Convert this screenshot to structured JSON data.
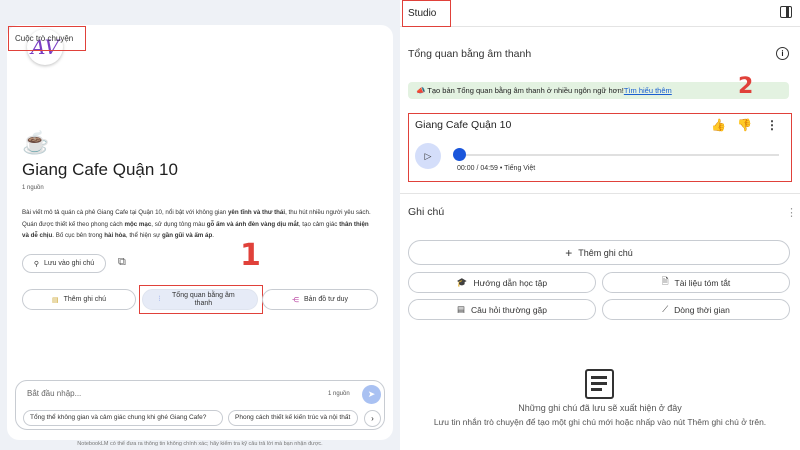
{
  "left": {
    "tab_label": "Cuộc trò chuyện",
    "source_emoji": "☕",
    "source_title": "Giang Cafe Quận 10",
    "source_count": "1 nguồn",
    "summary": {
      "p1": "Bài viết mô tả quán cà phê Giang Cafe tại Quận 10, nổi bật với không gian ",
      "b1": "yên tĩnh và thư thái",
      "p2": ", thu hút nhiều người yêu sách. Quán được thiết kế theo phong cách ",
      "b2": "mộc mạc",
      "p3": ", sử dụng tông màu ",
      "b3": "gỗ ấm và ánh đèn vàng dịu mắt",
      "p4": ", tạo cảm giác ",
      "b4": "thân thiện và dễ chịu",
      "p5": ". Bố cục bên trong ",
      "b5": "hài hòa",
      "p6": ", thể hiện sự ",
      "b6": "gần gũi và ấm áp",
      "p7": "."
    },
    "save_note_label": "Lưu vào ghi chú",
    "actions": {
      "add_note": "Thêm ghi chú",
      "audio_overview": "Tổng quan bằng âm thanh",
      "mind_map": "Bản đồ tư duy"
    },
    "annotation_1": "1",
    "composer": {
      "placeholder": "Bắt đầu nhập...",
      "source_count": "1 nguồn",
      "suggestions": [
        "Tổng thể không gian và cảm giác chung khi ghé Giang Cafe?",
        "Phong cách thiết kế kiến trúc và nội thất"
      ]
    },
    "disclaimer": "NotebookLM có thể đưa ra thông tin không chính xác; hãy kiểm tra kỹ câu trả lời mà bạn nhận được."
  },
  "studio": {
    "title": "Studio",
    "audio_section_title": "Tổng quan bằng âm thanh",
    "banner_text": "Tạo bản Tổng quan bằng âm thanh ở nhiều ngôn ngữ hơn!",
    "banner_link": "Tìm hiểu thêm",
    "annotation_2": "2",
    "player": {
      "title": "Giang Cafe Quận 10",
      "time": "00:00 / 04:59 • Tiếng Việt",
      "progress": 0
    },
    "notes_title": "Ghi chú",
    "add_note_label": "Thêm ghi chú",
    "tiles": {
      "study_guide": "Hướng dẫn học tập",
      "briefing_doc": "Tài liệu tóm tắt",
      "faq": "Câu hỏi thường gặp",
      "timeline": "Dòng thời gian"
    },
    "empty_title": "Những ghi chú đã lưu sẽ xuất hiện ở đây",
    "empty_desc": "Lưu tin nhắn trò chuyện để tạo một ghi chú mới hoặc nhấp vào nút Thêm ghi chú ở trên."
  },
  "colors": {
    "annotation": "#e0413a",
    "accent": "#1a56db",
    "banner_bg": "#e3f2e1"
  }
}
